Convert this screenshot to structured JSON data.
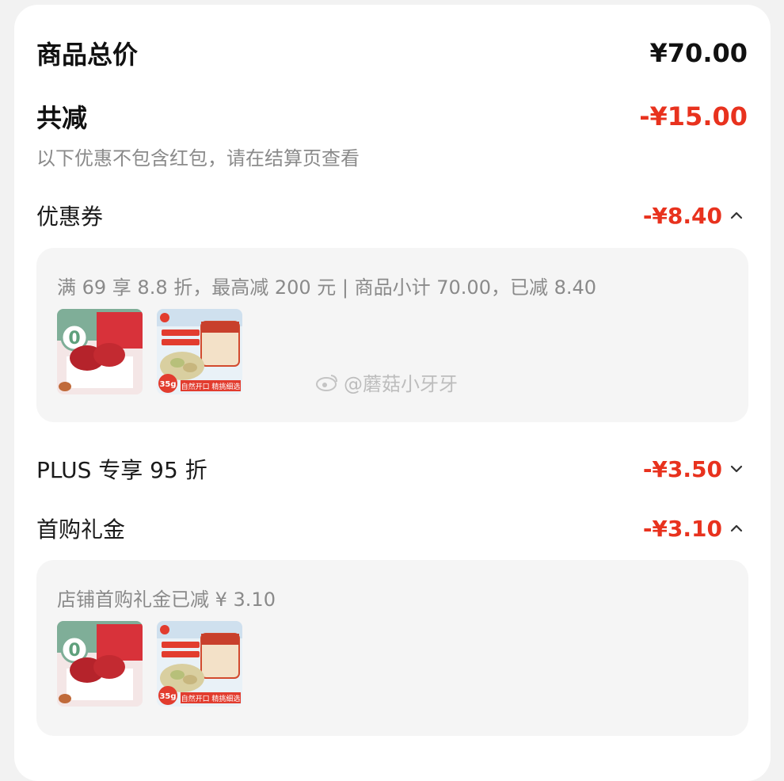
{
  "summary": {
    "total_label": "商品总价",
    "total_value": "¥70.00",
    "discount_label": "共减",
    "discount_value": "-¥15.00",
    "note": "以下优惠不包含红包，请在结算页查看"
  },
  "coupon": {
    "label": "优惠券",
    "value": "-¥8.40",
    "expanded": true,
    "detail": "满 69 享 8.8 折，最高减 200 元 | 商品小计 70.00，已减 8.40",
    "products": [
      {
        "name": "red-dates-product",
        "badge": "0"
      },
      {
        "name": "pistachio-product",
        "badge": "35g",
        "banner": "自然开口 精挑细选"
      }
    ]
  },
  "plus": {
    "label": "PLUS 专享 95 折",
    "value": "-¥3.50",
    "expanded": false
  },
  "first_buy": {
    "label": "首购礼金",
    "value": "-¥3.10",
    "expanded": true,
    "detail": "店铺首购礼金已减 ¥ 3.10",
    "products": [
      {
        "name": "red-dates-product",
        "badge": "0"
      },
      {
        "name": "pistachio-product",
        "badge": "35g",
        "banner": "自然开口 精挑细选"
      }
    ]
  },
  "watermark": "@蘑菇小牙牙",
  "colors": {
    "accent_red": "#e8321e",
    "muted_text": "#8a8a8a",
    "panel_bg": "#f5f5f5"
  }
}
